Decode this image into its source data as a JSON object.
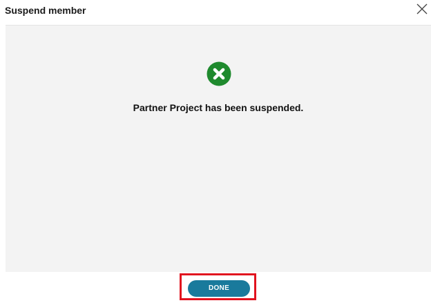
{
  "dialog": {
    "title": "Suspend member",
    "message": "Partner Project has been suspended.",
    "status_icon": "x-circle-icon",
    "close_icon": "close-icon",
    "done_label": "DONE"
  },
  "colors": {
    "status_icon": "#1f8a2e",
    "done_button": "#197a9c",
    "highlight_border": "#e1121e",
    "panel_background": "#f3f3f3"
  }
}
